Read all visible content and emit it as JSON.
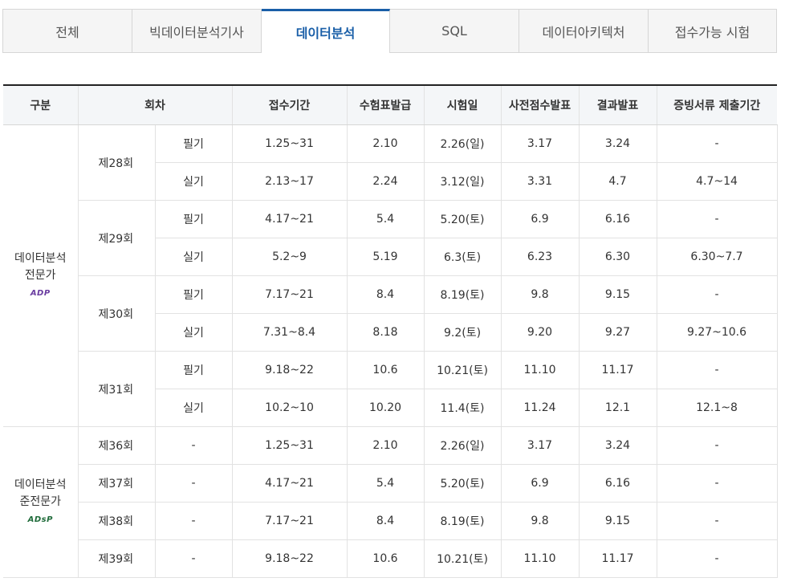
{
  "tabs": [
    "전체",
    "빅데이터분석기사",
    "데이터분석",
    "SQL",
    "데이터아키텍처",
    "접수가능 시험"
  ],
  "active_tab": "데이터분석",
  "headers": {
    "category": "구분",
    "round": "회차",
    "application": "접수기간",
    "ticket": "수험표발급",
    "exam_date": "시험일",
    "pre_score": "사전점수발표",
    "result": "결과발표",
    "docs": "증빙서류 제출기간"
  },
  "categories": {
    "adp": {
      "line1": "데이터분석",
      "line2": "전문가",
      "logo": "ADP",
      "logo_color": "#6a3ca0"
    },
    "adsp": {
      "line1": "데이터분석",
      "line2": "준전문가",
      "logo": "ADsP",
      "logo_color": "#1f6b3a"
    }
  },
  "adp_rounds": [
    {
      "round": "제28회",
      "rows": [
        {
          "type": "필기",
          "app": "1.25~31",
          "ticket": "2.10",
          "exam": "2.26(일)",
          "pre": "3.17",
          "result": "3.24",
          "docs": "-"
        },
        {
          "type": "실기",
          "app": "2.13~17",
          "ticket": "2.24",
          "exam": "3.12(일)",
          "pre": "3.31",
          "result": "4.7",
          "docs": "4.7~14"
        }
      ]
    },
    {
      "round": "제29회",
      "rows": [
        {
          "type": "필기",
          "app": "4.17~21",
          "ticket": "5.4",
          "exam": "5.20(토)",
          "pre": "6.9",
          "result": "6.16",
          "docs": "-"
        },
        {
          "type": "실기",
          "app": "5.2~9",
          "ticket": "5.19",
          "exam": "6.3(토)",
          "pre": "6.23",
          "result": "6.30",
          "docs": "6.30~7.7"
        }
      ]
    },
    {
      "round": "제30회",
      "rows": [
        {
          "type": "필기",
          "app": "7.17~21",
          "ticket": "8.4",
          "exam": "8.19(토)",
          "pre": "9.8",
          "result": "9.15",
          "docs": "-"
        },
        {
          "type": "실기",
          "app": "7.31~8.4",
          "ticket": "8.18",
          "exam": "9.2(토)",
          "pre": "9.20",
          "result": "9.27",
          "docs": "9.27~10.6"
        }
      ]
    },
    {
      "round": "제31회",
      "rows": [
        {
          "type": "필기",
          "app": "9.18~22",
          "ticket": "10.6",
          "exam": "10.21(토)",
          "pre": "11.10",
          "result": "11.17",
          "docs": "-"
        },
        {
          "type": "실기",
          "app": "10.2~10",
          "ticket": "10.20",
          "exam": "11.4(토)",
          "pre": "11.24",
          "result": "12.1",
          "docs": "12.1~8"
        }
      ]
    }
  ],
  "adsp_rounds": [
    {
      "round": "제36회",
      "type": "-",
      "app": "1.25~31",
      "ticket": "2.10",
      "exam": "2.26(일)",
      "pre": "3.17",
      "result": "3.24",
      "docs": "-"
    },
    {
      "round": "제37회",
      "type": "-",
      "app": "4.17~21",
      "ticket": "5.4",
      "exam": "5.20(토)",
      "pre": "6.9",
      "result": "6.16",
      "docs": "-"
    },
    {
      "round": "제38회",
      "type": "-",
      "app": "7.17~21",
      "ticket": "8.4",
      "exam": "8.19(토)",
      "pre": "9.8",
      "result": "9.15",
      "docs": "-"
    },
    {
      "round": "제39회",
      "type": "-",
      "app": "9.18~22",
      "ticket": "10.6",
      "exam": "10.21(토)",
      "pre": "11.10",
      "result": "11.17",
      "docs": "-"
    }
  ]
}
